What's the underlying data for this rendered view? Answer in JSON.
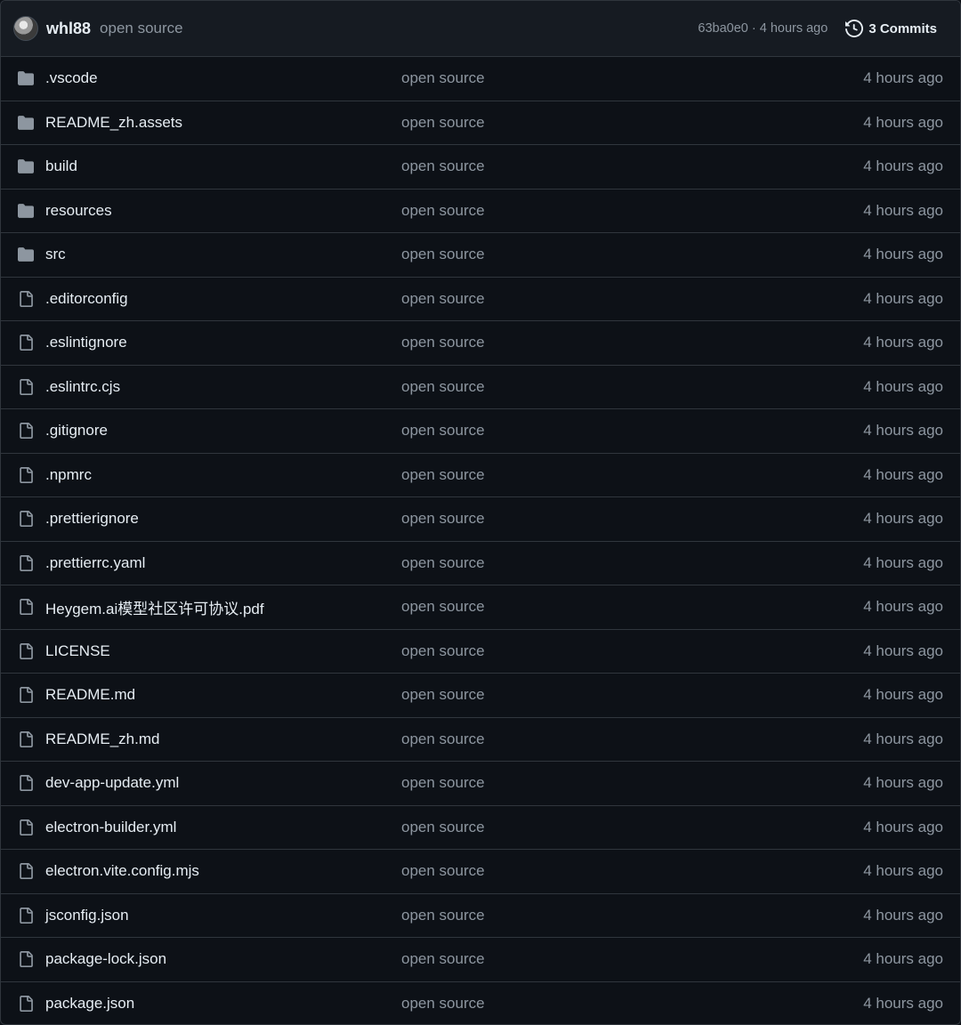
{
  "header": {
    "author": "whl88",
    "message": "open source",
    "commit_meta": "63ba0e0 · 4 hours ago",
    "commits_label": "3 Commits"
  },
  "colors": {
    "background": "#0d1117",
    "header_bg": "#161b22",
    "border": "#30363d",
    "text": "#e6edf3",
    "muted": "#8d96a0",
    "folder_icon": "#8d96a0"
  },
  "files": [
    {
      "type": "folder",
      "name": ".vscode",
      "message": "open source",
      "time": "4 hours ago"
    },
    {
      "type": "folder",
      "name": "README_zh.assets",
      "message": "open source",
      "time": "4 hours ago"
    },
    {
      "type": "folder",
      "name": "build",
      "message": "open source",
      "time": "4 hours ago"
    },
    {
      "type": "folder",
      "name": "resources",
      "message": "open source",
      "time": "4 hours ago"
    },
    {
      "type": "folder",
      "name": "src",
      "message": "open source",
      "time": "4 hours ago"
    },
    {
      "type": "file",
      "name": ".editorconfig",
      "message": "open source",
      "time": "4 hours ago"
    },
    {
      "type": "file",
      "name": ".eslintignore",
      "message": "open source",
      "time": "4 hours ago"
    },
    {
      "type": "file",
      "name": ".eslintrc.cjs",
      "message": "open source",
      "time": "4 hours ago"
    },
    {
      "type": "file",
      "name": ".gitignore",
      "message": "open source",
      "time": "4 hours ago"
    },
    {
      "type": "file",
      "name": ".npmrc",
      "message": "open source",
      "time": "4 hours ago"
    },
    {
      "type": "file",
      "name": ".prettierignore",
      "message": "open source",
      "time": "4 hours ago"
    },
    {
      "type": "file",
      "name": ".prettierrc.yaml",
      "message": "open source",
      "time": "4 hours ago"
    },
    {
      "type": "file",
      "name": "Heygem.ai模型社区许可协议.pdf",
      "message": "open source",
      "time": "4 hours ago"
    },
    {
      "type": "file",
      "name": "LICENSE",
      "message": "open source",
      "time": "4 hours ago"
    },
    {
      "type": "file",
      "name": "README.md",
      "message": "open source",
      "time": "4 hours ago"
    },
    {
      "type": "file",
      "name": "README_zh.md",
      "message": "open source",
      "time": "4 hours ago"
    },
    {
      "type": "file",
      "name": "dev-app-update.yml",
      "message": "open source",
      "time": "4 hours ago"
    },
    {
      "type": "file",
      "name": "electron-builder.yml",
      "message": "open source",
      "time": "4 hours ago"
    },
    {
      "type": "file",
      "name": "electron.vite.config.mjs",
      "message": "open source",
      "time": "4 hours ago"
    },
    {
      "type": "file",
      "name": "jsconfig.json",
      "message": "open source",
      "time": "4 hours ago"
    },
    {
      "type": "file",
      "name": "package-lock.json",
      "message": "open source",
      "time": "4 hours ago"
    },
    {
      "type": "file",
      "name": "package.json",
      "message": "open source",
      "time": "4 hours ago"
    }
  ]
}
